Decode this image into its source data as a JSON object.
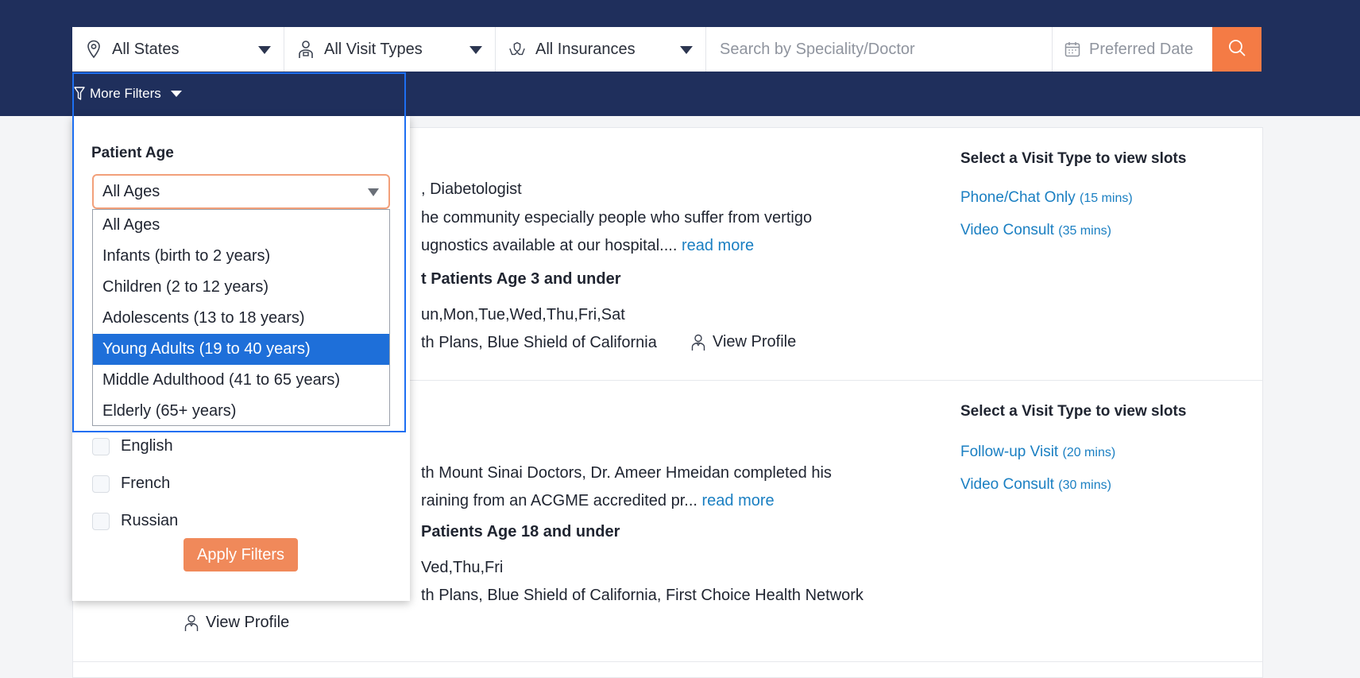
{
  "search_bar": {
    "states": "All States",
    "visit_types": "All Visit Types",
    "insurances": "All Insurances",
    "search_placeholder": "Search by Speciality/Doctor",
    "date_placeholder": "Preferred Date"
  },
  "more_filters": {
    "label": "More Filters",
    "patient_age_title": "Patient Age",
    "selected_age": "All Ages",
    "age_options": [
      "All Ages",
      "Infants (birth to 2 years)",
      "Children (2 to 12 years)",
      "Adolescents (13 to 18 years)",
      "Young Adults (19 to 40 years)",
      "Middle Adulthood (41 to 65 years)",
      "Elderly (65+ years)"
    ],
    "highlighted_option": "Young Adults (19 to 40 years)",
    "languages": [
      "English",
      "French",
      "Russian"
    ],
    "apply_label": "Apply Filters"
  },
  "results": [
    {
      "specialty_fragment": ", Diabetologist",
      "bio_line1": "he community especially people who suffer from vertigo",
      "bio_line2": "ugnostics available at our hospital.... ",
      "read_more": "read more",
      "age_note": "t Patients Age 3 and under",
      "days": "un,Mon,Tue,Wed,Thu,Fri,Sat",
      "insurances": "th Plans, Blue Shield of California",
      "view_profile": "View Profile",
      "slot_title": "Select a Visit Type to view slots",
      "slots": [
        {
          "name": "Phone/Chat Only",
          "duration": "(15 mins)"
        },
        {
          "name": "Video Consult",
          "duration": "(35 mins)"
        }
      ]
    },
    {
      "bio_line1": "th Mount Sinai Doctors, Dr. Ameer Hmeidan completed his",
      "bio_line2": "raining from an ACGME accredited pr... ",
      "read_more": "read more",
      "age_note": "Patients Age 18 and under",
      "days": "Ved,Thu,Fri",
      "insurances": "th Plans, Blue Shield of California, First Choice Health Network",
      "view_profile": "View Profile",
      "slot_title": "Select a Visit Type to view slots",
      "slots": [
        {
          "name": "Follow-up Visit",
          "duration": "(20 mins)"
        },
        {
          "name": "Video Consult",
          "duration": "(30 mins)"
        }
      ]
    }
  ],
  "colors": {
    "header_bg": "#1f2f5c",
    "accent_orange": "#f47b45",
    "link_blue": "#1a7fc2",
    "selected_option": "#1e6fd9",
    "focus_outline": "#1d6ff2"
  }
}
